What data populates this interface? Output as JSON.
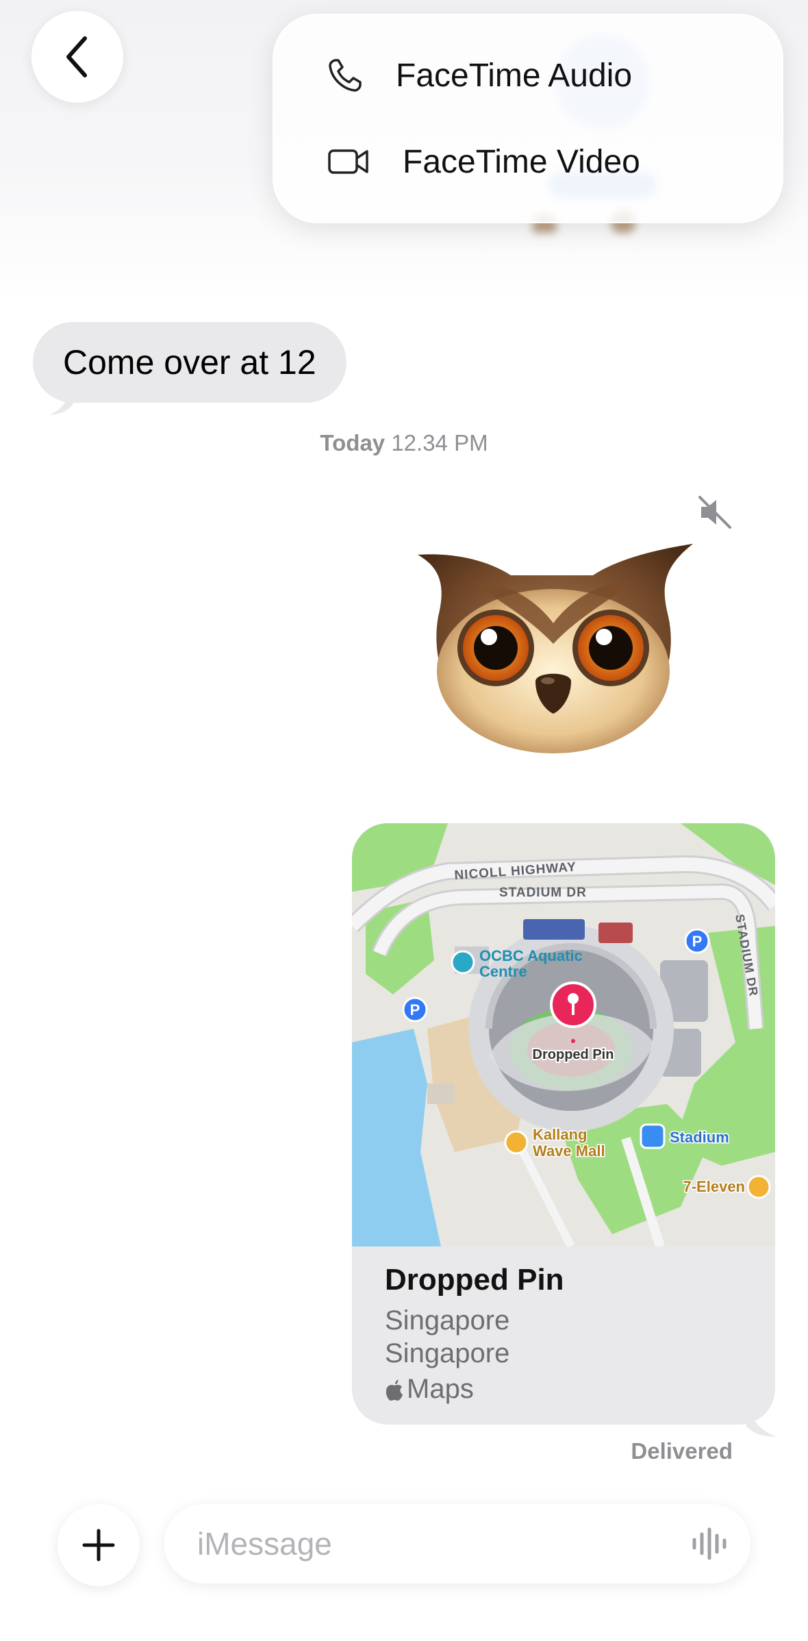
{
  "header": {
    "back_label": "Back",
    "call_menu": {
      "items": [
        {
          "label": "FaceTime Audio",
          "icon": "phone-icon"
        },
        {
          "label": "FaceTime Video",
          "icon": "video-camera-icon"
        }
      ]
    }
  },
  "messages": {
    "incoming_text": "Come over at 12",
    "timestamp_day": "Today",
    "timestamp_time": "12.34 PM",
    "memoji_sticker": "owl-memoji",
    "location_card": {
      "map_labels": {
        "road_1": "NICOLL HIGHWAY",
        "road_2": "STADIUM DR",
        "road_3": "STADIUM DR",
        "poi_aquatic": [
          "OCBC Aquatic",
          "Centre"
        ],
        "poi_pin": "Dropped Pin",
        "poi_mall": [
          "Kallang",
          "Wave Mall"
        ],
        "poi_station": "Stadium",
        "poi_store": "7-Eleven",
        "parking": "P"
      },
      "title": "Dropped Pin",
      "line1": "Singapore",
      "line2": "Singapore",
      "source": "Maps"
    },
    "status": "Delivered"
  },
  "composer": {
    "placeholder": "iMessage",
    "plus_icon": "plus-icon",
    "mic_icon": "audio-waveform-icon"
  },
  "colors": {
    "incoming_bubble": "#e9e9eb",
    "pin_red": "#e8265a",
    "map_green": "#9edc82",
    "water_blue": "#8ecdf0"
  }
}
